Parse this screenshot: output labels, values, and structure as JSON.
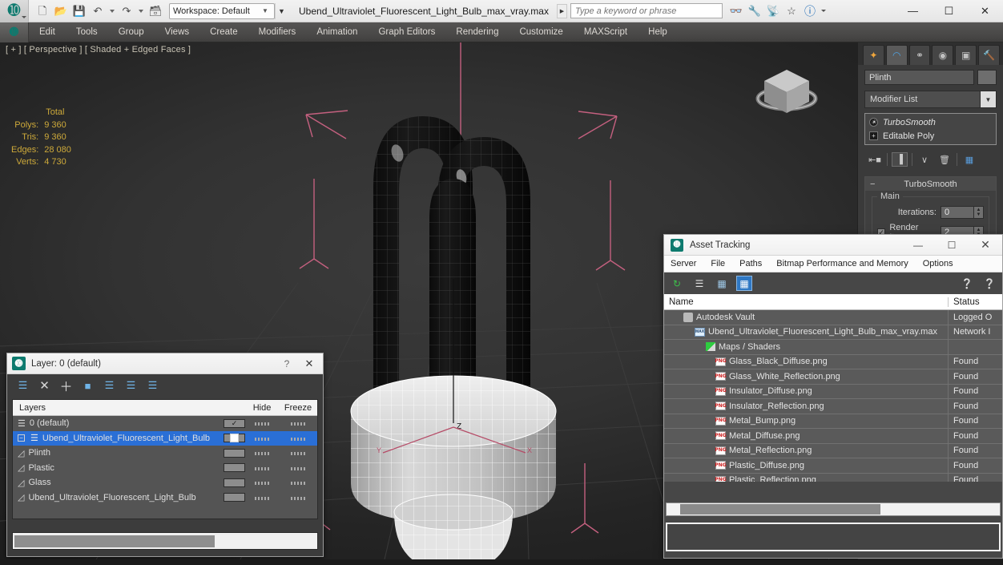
{
  "titlebar": {
    "app_icon": "3dsmax-logo-icon",
    "quick_access": [
      {
        "name": "new-file",
        "glyph": "⬜"
      },
      {
        "name": "open-file",
        "glyph": "📂"
      },
      {
        "name": "save-file",
        "glyph": "💾"
      },
      {
        "name": "undo",
        "glyph": "↶"
      },
      {
        "name": "redo",
        "glyph": "↷"
      },
      {
        "name": "set-project-folder",
        "glyph": "🗂"
      }
    ],
    "workspace_label": "Workspace: Default",
    "document_title": "Ubend_Ultraviolet_Fluorescent_Light_Bulb_max_vray.max",
    "search_placeholder": "Type a keyword or phrase",
    "tool_icons": [
      "binoculars-icon",
      "wrench-icon",
      "satellite-icon",
      "star-icon",
      "help-icon"
    ],
    "window_buttons": {
      "minimize": "—",
      "maximize": "☐",
      "close": "✕"
    }
  },
  "menubar": {
    "items": [
      "Edit",
      "Tools",
      "Group",
      "Views",
      "Create",
      "Modifiers",
      "Animation",
      "Graph Editors",
      "Rendering",
      "Customize",
      "MAXScript",
      "Help"
    ]
  },
  "viewport": {
    "label": "[ + ] [ Perspective ] [ Shaded + Edged Faces ]",
    "stats_header": "Total",
    "stats": [
      {
        "key": "Polys:",
        "value": "9 360"
      },
      {
        "key": "Tris:",
        "value": "9 360"
      },
      {
        "key": "Edges:",
        "value": "28 080"
      },
      {
        "key": "Verts:",
        "value": "4 730"
      }
    ],
    "axis_labels": {
      "z": "Z",
      "x": "X",
      "y": "Y"
    },
    "colors": {
      "stats_text": "#cda93a",
      "gizmo": "#d4678a",
      "background": "#333333"
    }
  },
  "command_panel": {
    "tabs": [
      {
        "name": "create-tab",
        "glyph": "✶",
        "active": false
      },
      {
        "name": "modify-tab",
        "glyph": "◜",
        "active": true
      },
      {
        "name": "hierarchy-tab",
        "glyph": "⛓",
        "active": false
      },
      {
        "name": "motion-tab",
        "glyph": "◎",
        "active": false
      },
      {
        "name": "display-tab",
        "glyph": "▣",
        "active": false
      },
      {
        "name": "utilities-tab",
        "glyph": "🔨",
        "active": false
      }
    ],
    "object_name": "Plinth",
    "modifier_list_label": "Modifier List",
    "stack": [
      {
        "label": "TurboSmooth",
        "italic": true,
        "icon": "bulb-icon"
      },
      {
        "label": "Editable Poly",
        "italic": false,
        "icon": "plus-icon"
      }
    ],
    "stack_tools": [
      "pin-stack-icon",
      "show-end-result-icon",
      "make-unique-icon",
      "remove-modifier-icon",
      "configure-sets-icon"
    ],
    "rollout": {
      "title": "TurboSmooth",
      "group_label": "Main",
      "iterations_label": "Iterations:",
      "iterations_value": "0",
      "render_iters_label": "Render Iters:",
      "render_iters_value": "2",
      "render_iters_checked": true
    }
  },
  "layer_dialog": {
    "title": "Layer: 0 (default)",
    "help_glyph": "?",
    "close_glyph": "✕",
    "toolbar": [
      "new-layer-icon",
      "delete-layer-icon",
      "add-layer-icon",
      "select-objects-in-layer-icon",
      "select-highlighted-layer-icon",
      "add-selection-to-layer-icon",
      "set-current-layer-icon"
    ],
    "columns": {
      "layers": "Layers",
      "hide": "Hide",
      "freeze": "Freeze"
    },
    "rows": [
      {
        "name": "0 (default)",
        "indent": 1,
        "selected": false,
        "current": true,
        "hide": "",
        "freeze": ""
      },
      {
        "name": "Ubend_Ultraviolet_Fluorescent_Light_Bulb",
        "indent": 1,
        "selected": true,
        "current": false,
        "hide": "",
        "freeze": ""
      },
      {
        "name": "Plinth",
        "indent": 2,
        "selected": false,
        "current": false,
        "hide": "",
        "freeze": ""
      },
      {
        "name": "Plastic",
        "indent": 2,
        "selected": false,
        "current": false,
        "hide": "",
        "freeze": ""
      },
      {
        "name": "Glass",
        "indent": 2,
        "selected": false,
        "current": false,
        "hide": "",
        "freeze": ""
      },
      {
        "name": "Ubend_Ultraviolet_Fluorescent_Light_Bulb",
        "indent": 2,
        "selected": false,
        "current": false,
        "hide": "",
        "freeze": ""
      }
    ]
  },
  "asset_dialog": {
    "title": "Asset Tracking",
    "window_buttons": {
      "minimize": "—",
      "maximize": "☐",
      "close": "✕"
    },
    "menu": [
      "Server",
      "File",
      "Paths",
      "Bitmap Performance and Memory",
      "Options"
    ],
    "toolbar": [
      "refresh-icon",
      "list-view-icon",
      "thumbnail-view-icon",
      "grid-view-icon"
    ],
    "toolbar_right": [
      "help-question-icon",
      "context-help-icon"
    ],
    "columns": {
      "name": "Name",
      "status": "Status"
    },
    "rows": [
      {
        "name": "Autodesk Vault",
        "status": "Logged O",
        "icon": "vault-icon",
        "indent": 1
      },
      {
        "name": "Ubend_Ultraviolet_Fluorescent_Light_Bulb_max_vray.max",
        "status": "Network I",
        "icon": "max-file-icon",
        "indent": 2
      },
      {
        "name": "Maps / Shaders",
        "status": "",
        "icon": "maps-shaders-icon",
        "indent": 3
      },
      {
        "name": "Glass_Black_Diffuse.png",
        "status": "Found",
        "icon": "png-icon",
        "indent": 4
      },
      {
        "name": "Glass_White_Reflection.png",
        "status": "Found",
        "icon": "png-icon",
        "indent": 4
      },
      {
        "name": "Insulator_Diffuse.png",
        "status": "Found",
        "icon": "png-icon",
        "indent": 4
      },
      {
        "name": "Insulator_Reflection.png",
        "status": "Found",
        "icon": "png-icon",
        "indent": 4
      },
      {
        "name": "Metal_Bump.png",
        "status": "Found",
        "icon": "png-icon",
        "indent": 4
      },
      {
        "name": "Metal_Diffuse.png",
        "status": "Found",
        "icon": "png-icon",
        "indent": 4
      },
      {
        "name": "Metal_Reflection.png",
        "status": "Found",
        "icon": "png-icon",
        "indent": 4
      },
      {
        "name": "Plastic_Diffuse.png",
        "status": "Found",
        "icon": "png-icon",
        "indent": 4
      },
      {
        "name": "Plastic_Reflection.png",
        "status": "Found",
        "icon": "png-icon",
        "indent": 4
      }
    ]
  }
}
